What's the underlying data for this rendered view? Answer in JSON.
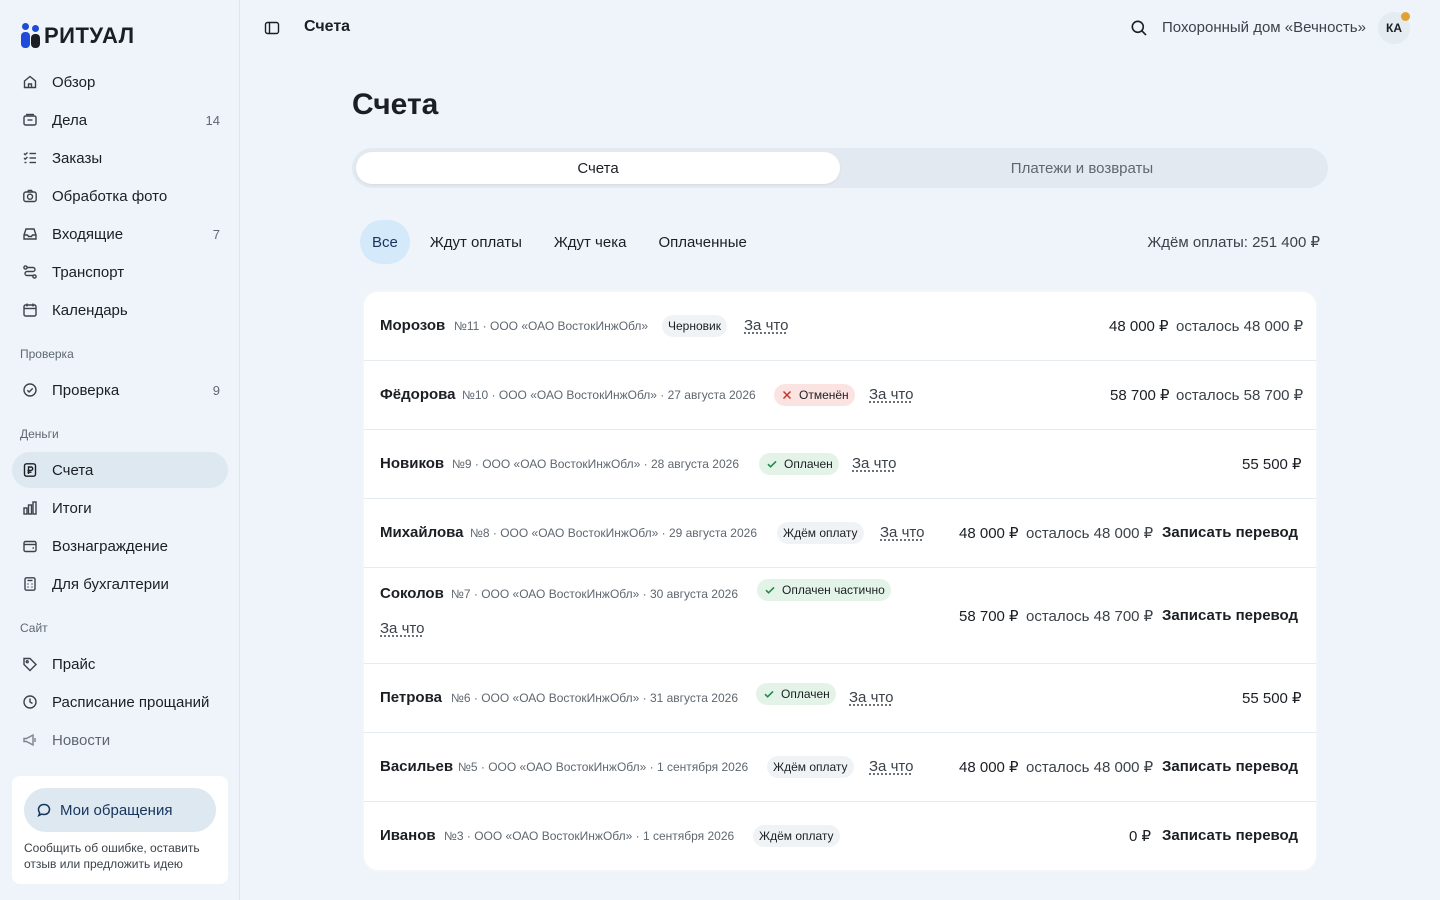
{
  "brand": {
    "logo_text": "РИТУАЛ",
    "tm": "(R)"
  },
  "sidebar": {
    "items": [
      {
        "label": "Обзор",
        "count": ""
      },
      {
        "label": "Дела",
        "count": "14"
      },
      {
        "label": "Заказы",
        "count": ""
      },
      {
        "label": "Обработка фото",
        "count": ""
      },
      {
        "label": "Входящие",
        "count": "7"
      },
      {
        "label": "Транспорт",
        "count": ""
      },
      {
        "label": "Календарь",
        "count": ""
      }
    ],
    "section_check": "Проверка",
    "check_items": [
      {
        "label": "Проверка",
        "count": "9"
      }
    ],
    "section_money": "Деньги",
    "money_items": [
      {
        "label": "Счета"
      },
      {
        "label": "Итоги"
      },
      {
        "label": "Вознаграждение"
      },
      {
        "label": "Для бухгалтерии"
      }
    ],
    "section_site": "Сайт",
    "site_items": [
      {
        "label": "Прайс"
      },
      {
        "label": "Расписание прощаний"
      },
      {
        "label": "Новости"
      }
    ],
    "help": {
      "button": "Мои обращения",
      "text": "Сообщить об ошибке, оставить отзыв или предложить идею"
    }
  },
  "header": {
    "title": "Счета",
    "org": "Похоронный дом «Вечность»",
    "avatar": "КА"
  },
  "main": {
    "title": "Счета",
    "tabs": [
      "Счета",
      "Платежи и возвраты"
    ],
    "filters": [
      "Все",
      "Ждут оплаты",
      "Ждут чека",
      "Оплаченные"
    ],
    "awaiting_total": "Ждём оплаты: 251 400 ₽",
    "what_label": "За что",
    "record_label": "Записать перевод",
    "rows": [
      {
        "name": "Морозов",
        "meta": "№11 · ООО «ОАО ВостокИнжОбл»",
        "badge": "Черновик",
        "amount": "48 000 ₽",
        "left": "осталось 48 000 ₽"
      },
      {
        "name": "Фёдорова",
        "meta": "№10 · ООО «ОАО ВостокИнжОбл» · 27 августа 2026",
        "badge": "Отменён",
        "amount": "58 700 ₽",
        "left": "осталось 58 700 ₽"
      },
      {
        "name": "Новиков",
        "meta": "№9 · ООО «ОАО ВостокИнжОбл» · 28 августа 2026",
        "badge": "Оплачен",
        "amount": "55 500 ₽"
      },
      {
        "name": "Михайлова",
        "meta": "№8 · ООО «ОАО ВостокИнжОбл» · 29 августа 2026",
        "badge": "Ждём оплату",
        "amount": "48 000 ₽",
        "left": "осталось 48 000 ₽"
      },
      {
        "name": "Соколов",
        "meta": "№7 · ООО «ОАО ВостокИнжОбл» · 30 августа 2026",
        "badge": "Оплачен частично",
        "amount": "58 700 ₽",
        "left": "осталось 48 700 ₽"
      },
      {
        "name": "Петрова",
        "meta": "№6 · ООО «ОАО ВостокИнжОбл» · 31 августа 2026",
        "badge": "Оплачен",
        "amount": "55 500 ₽"
      },
      {
        "name": "Васильев",
        "meta": "№5 · ООО «ОАО ВостокИнжОбл» · 1 сентября 2026",
        "badge": "Ждём оплату",
        "amount": "48 000 ₽",
        "left": "осталось 48 000 ₽"
      },
      {
        "name": "Иванов",
        "meta": "№3 · ООО «ОАО ВостокИнжОбл» · 1 сентября 2026",
        "badge": "Ждём оплату",
        "amount": "0 ₽"
      }
    ]
  },
  "colors": {
    "accent": "#1f4bd8",
    "background": "#eef4f9",
    "active_chip": "#d4e9f9",
    "badge_paid": "#e3f3e8",
    "badge_cancelled": "#fbe3e2",
    "notification_dot": "#e3a033"
  }
}
